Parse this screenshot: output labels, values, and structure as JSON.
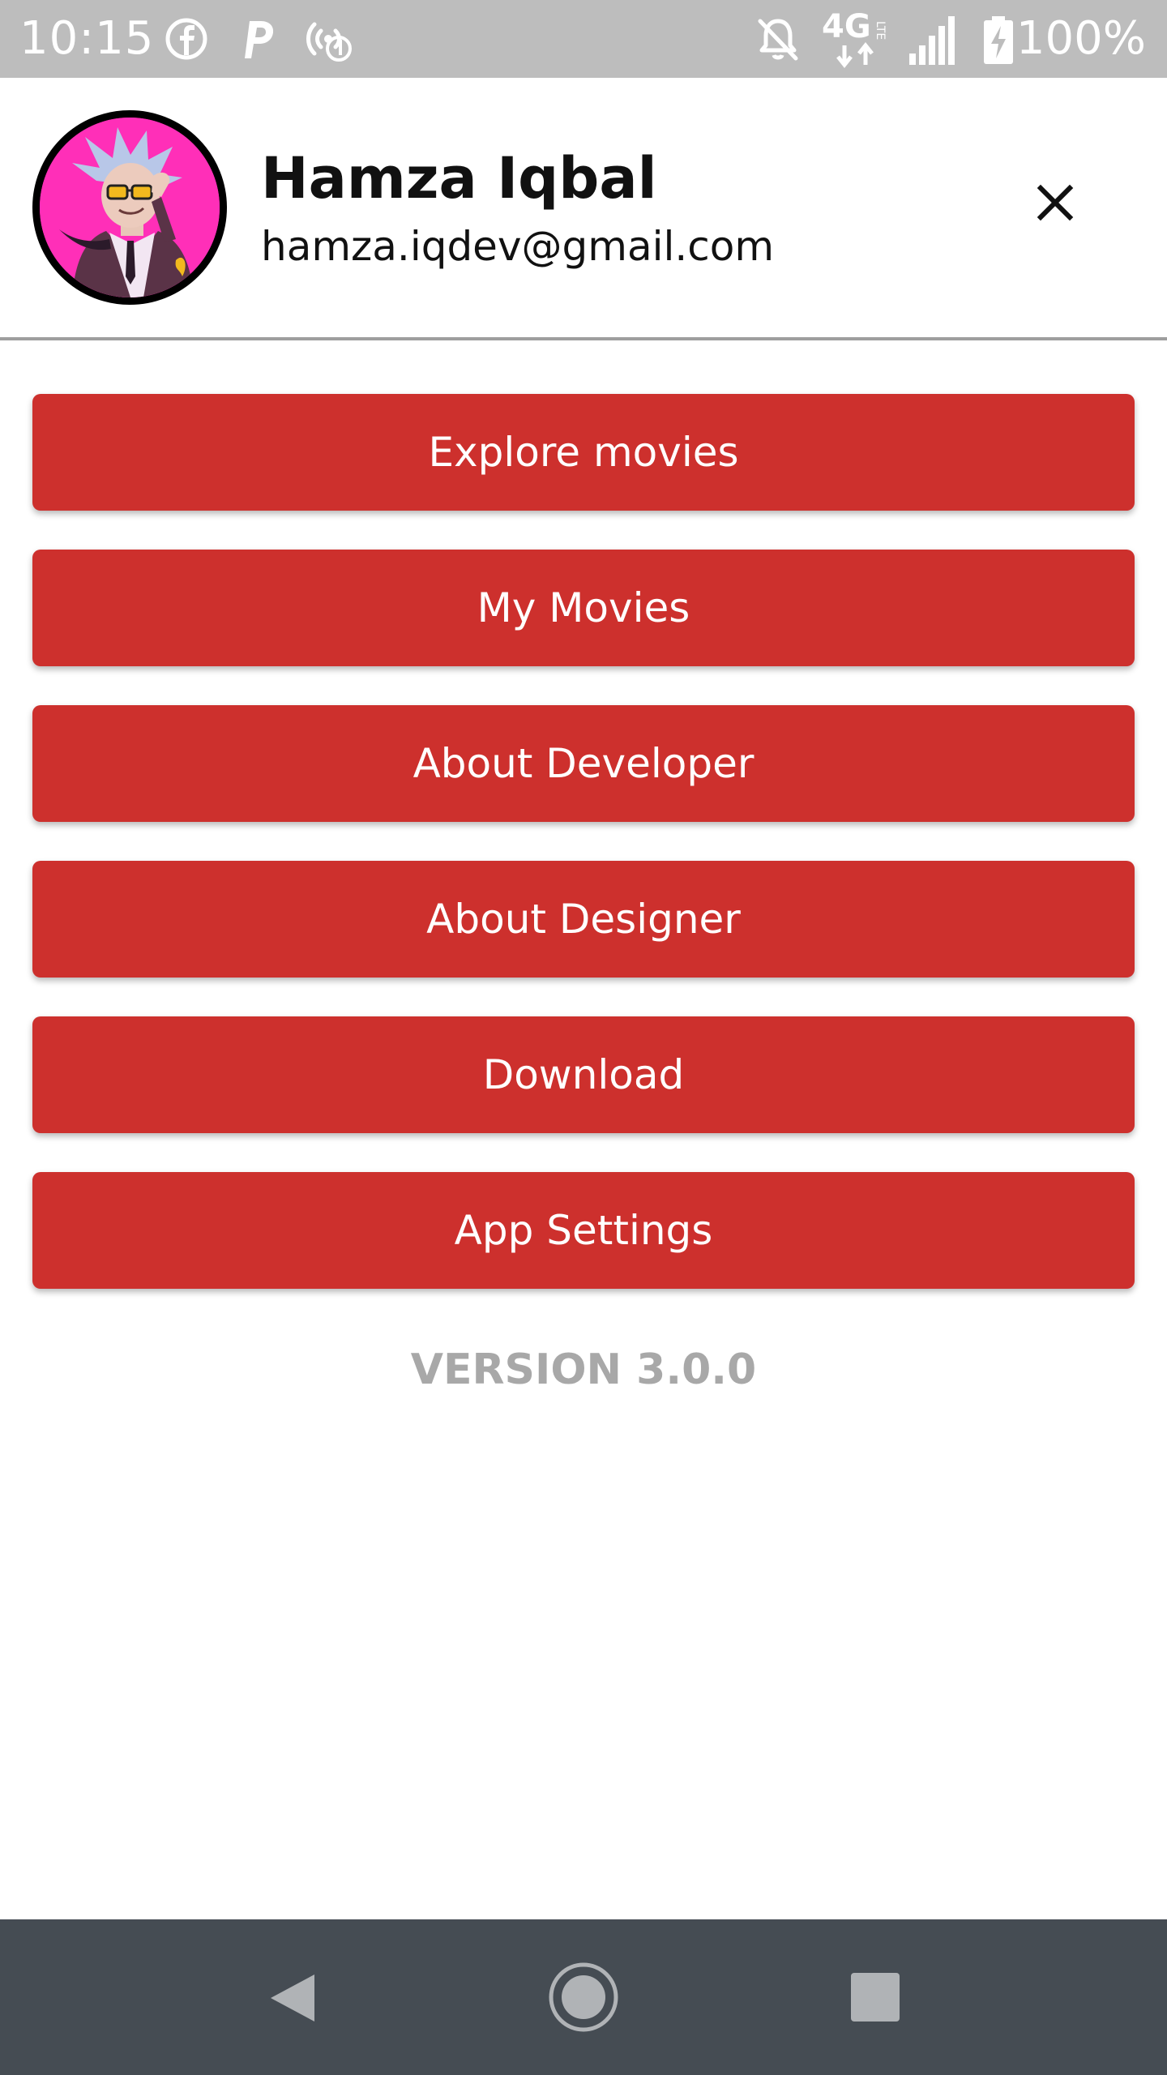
{
  "status_bar": {
    "time": "10:15",
    "battery_percent": "100%",
    "network_label": "4G",
    "icons": [
      "facebook-icon",
      "parking-icon",
      "hotspot-icon",
      "notifications-off-icon",
      "network-4g-lte-icon",
      "signal-icon",
      "battery-charging-icon"
    ]
  },
  "profile": {
    "name": "Hamza Iqbal",
    "email": "hamza.iqdev@gmail.com",
    "avatar_icon": "avatar-cartoon",
    "close_icon": "close-icon"
  },
  "menu": {
    "items": [
      {
        "label": "Explore movies"
      },
      {
        "label": "My Movies"
      },
      {
        "label": "About Developer"
      },
      {
        "label": "About Designer"
      },
      {
        "label": "Download"
      },
      {
        "label": "App Settings"
      }
    ]
  },
  "footer": {
    "version": "VERSION 3.0.0"
  },
  "nav_bar": {
    "icons": [
      "back-icon",
      "home-icon",
      "recents-icon"
    ]
  },
  "colors": {
    "status_bar": "#bdbdbd",
    "menu_button": "#cd302d",
    "menu_text": "#ffffff",
    "version_text": "#a8a8a8",
    "nav_bar": "#454c53",
    "avatar_bg": "#ff2fb8"
  }
}
